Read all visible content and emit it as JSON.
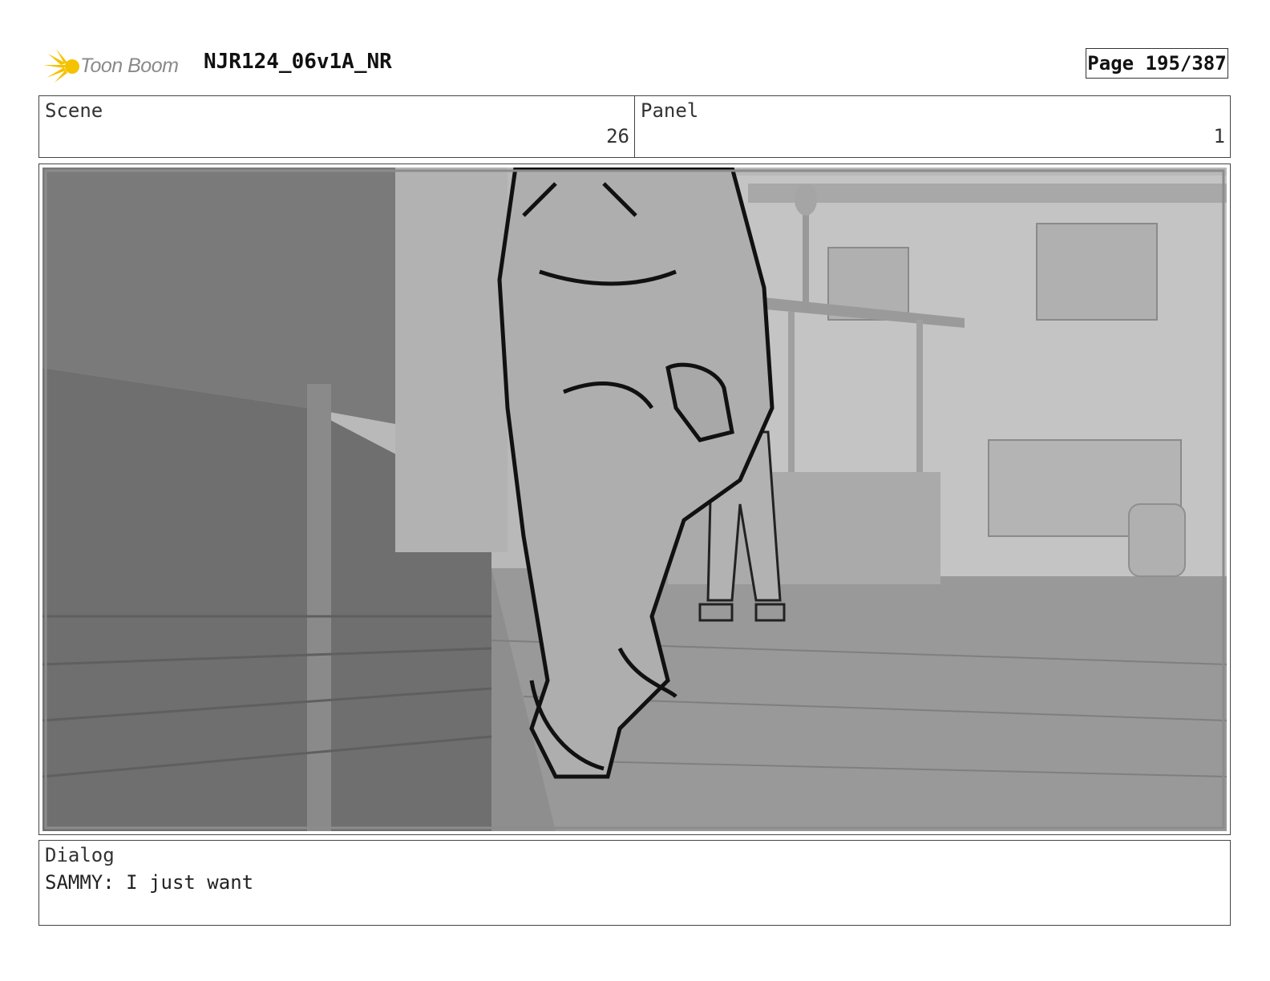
{
  "header": {
    "logo_text": "Toon Boom",
    "document_title": "NJR124_06v1A_NR",
    "page_label": "Page 195/387"
  },
  "scene": {
    "label": "Scene",
    "value": "26"
  },
  "panel": {
    "label": "Panel",
    "value": "1"
  },
  "dialog": {
    "label": "Dialog",
    "text": "SAMMY: I just want"
  },
  "colors": {
    "logo_yellow": "#f5c200",
    "logo_gray": "#8a8a8a",
    "frame_gray": "#9a9a9a"
  }
}
